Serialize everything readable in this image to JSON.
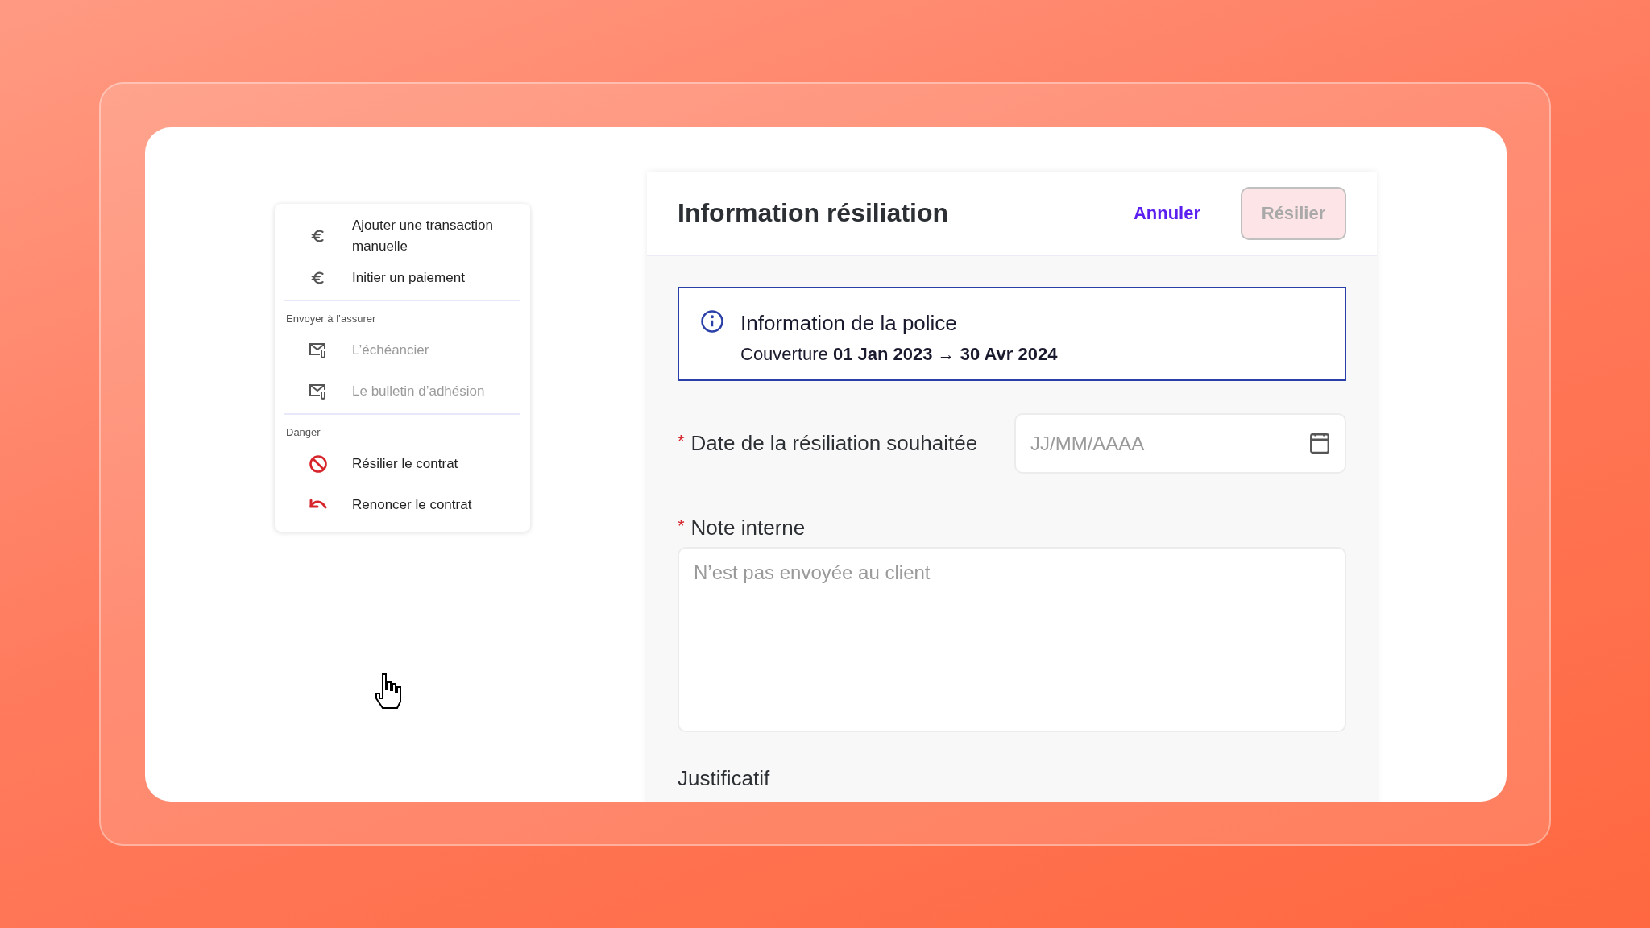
{
  "menu": {
    "groups": [
      {
        "items": [
          {
            "label": "Ajouter une transaction manuelle",
            "kind": "euro",
            "disabled": false
          },
          {
            "label": "Initier un paiement",
            "kind": "euro",
            "disabled": false
          }
        ]
      },
      {
        "heading": "Envoyer à l’assurer",
        "items": [
          {
            "label": "L’échéancier",
            "kind": "mail",
            "disabled": true
          },
          {
            "label": "Le bulletin d’adhésion",
            "kind": "mail",
            "disabled": true
          }
        ]
      },
      {
        "heading": "Danger",
        "items": [
          {
            "label": "Résilier le contrat",
            "kind": "forbid",
            "disabled": false
          },
          {
            "label": "Renoncer le contrat",
            "kind": "undo",
            "disabled": false
          }
        ]
      }
    ]
  },
  "form": {
    "title": "Information résiliation",
    "buttons": [
      {
        "label": "Annuler",
        "kind": "link",
        "disabled": false
      },
      {
        "label": "Résilier",
        "kind": "danger",
        "disabled": true
      }
    ],
    "info": {
      "title": "Information de la police",
      "text": "Couverture **01 Jan 2023 → 30 Avr 2024**"
    },
    "fields": [
      {
        "kind": "date",
        "label": "Date de la résiliation souhaitée",
        "required_mark": "*",
        "placeholder": "JJ/MM/AAAA"
      },
      {
        "kind": "textarea",
        "label": "Note interne",
        "required_mark": "*",
        "placeholder": "N’est pas envoyée au client"
      },
      {
        "kind": "upload",
        "label": "Justificatif"
      }
    ]
  }
}
